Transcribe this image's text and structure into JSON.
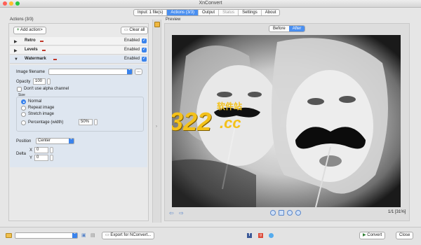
{
  "window": {
    "title": "XnConvert"
  },
  "tabs": [
    {
      "label": "Input: 1 file(s)",
      "state": "normal"
    },
    {
      "label": "Actions (3/3)",
      "state": "active"
    },
    {
      "label": "Output",
      "state": "normal"
    },
    {
      "label": "Status",
      "state": "disabled"
    },
    {
      "label": "Settings",
      "state": "normal"
    },
    {
      "label": "About",
      "state": "normal"
    }
  ],
  "actions_panel": {
    "title": "Actions (3/3)",
    "add_button": "Add action>",
    "clear_button": "Clear all",
    "actions": [
      {
        "name": "Retro",
        "status": "Enabled",
        "enabled": true
      },
      {
        "name": "Levels",
        "status": "Enabled",
        "enabled": true
      },
      {
        "name": "Watermark",
        "status": "Enabled",
        "enabled": true
      }
    ],
    "watermark": {
      "image_filename_label": "Image filename",
      "image_filename_value": "",
      "browse_button": "...",
      "opacity_label": "Opacity",
      "opacity_value": "100",
      "alpha_label": "Don't use alpha channel",
      "size_group_label": "Size",
      "size_options": [
        "Normal",
        "Repeat image",
        "Stretch image",
        "Percentage (width)"
      ],
      "size_selected": "Normal",
      "percentage_value": "50%",
      "position_label": "Position",
      "position_value": "Center",
      "delta_label": "Delta",
      "delta_x_label": "X",
      "delta_x_value": "0",
      "delta_y_label": "Y",
      "delta_y_value": "0"
    }
  },
  "preview": {
    "title": "Preview",
    "before_label": "Before",
    "after_label": "After",
    "watermark_text": "3322",
    "watermark_suffix": ".cc",
    "watermark_cn": "软件站",
    "page_indicator": "1/1 [31%]"
  },
  "bottom": {
    "export_button": "Export for NConvert...",
    "convert_button": "Convert",
    "close_button": "Close"
  },
  "colors": {
    "accent": "#4a8ff0",
    "watermark_yellow": "#f3c11b",
    "watermark_green": "#39b54a"
  }
}
